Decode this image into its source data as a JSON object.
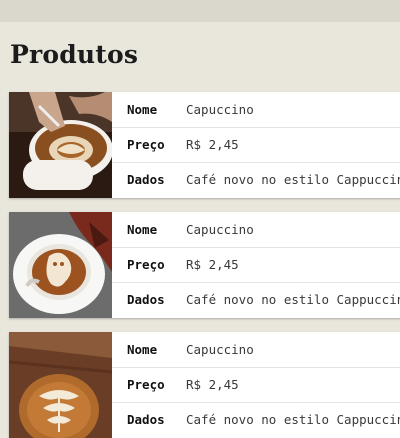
{
  "page": {
    "title": "Produtos"
  },
  "products": [
    {
      "image": "latte-art-pouring-photo",
      "name_label": "Nome",
      "name": "Capuccino",
      "price_label": "Preço",
      "price": "R$ 2,45",
      "info_label": "Dados",
      "info": "Café novo no estilo Cappuccino"
    },
    {
      "image": "latte-art-ghost-photo",
      "name_label": "Nome",
      "name": "Capuccino",
      "price_label": "Preço",
      "price": "R$ 2,45",
      "info_label": "Dados",
      "info": "Café novo no estilo Cappuccino"
    },
    {
      "image": "latte-art-tulip-photo",
      "name_label": "Nome",
      "name": "Capuccino",
      "price_label": "Preço",
      "price": "R$ 2,45",
      "info_label": "Dados",
      "info": "Café novo no estilo Cappuccino"
    }
  ]
}
